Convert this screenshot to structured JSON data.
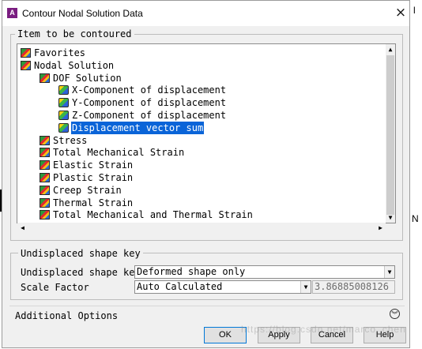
{
  "window": {
    "title": "Contour Nodal Solution Data",
    "close_glyph": "×"
  },
  "edge_right_text": "N",
  "edge_right_top_text": "l",
  "item_group": {
    "legend": "Item to be contoured"
  },
  "tree": [
    {
      "label": "Favorites",
      "icon": "folder-icon",
      "indent": 0,
      "selected": false
    },
    {
      "label": "Nodal Solution",
      "icon": "folder-icon",
      "indent": 0,
      "selected": false
    },
    {
      "label": "DOF Solution",
      "icon": "folder-icon",
      "indent": 1,
      "selected": false
    },
    {
      "label": "X-Component of displacement",
      "icon": "result-item-icon",
      "indent": 2,
      "selected": false
    },
    {
      "label": "Y-Component of displacement",
      "icon": "result-item-icon",
      "indent": 2,
      "selected": false
    },
    {
      "label": "Z-Component of displacement",
      "icon": "result-item-icon",
      "indent": 2,
      "selected": false
    },
    {
      "label": "Displacement vector sum",
      "icon": "result-item-icon",
      "indent": 2,
      "selected": true
    },
    {
      "label": "Stress",
      "icon": "folder-icon",
      "indent": 1,
      "selected": false
    },
    {
      "label": "Total Mechanical Strain",
      "icon": "folder-icon",
      "indent": 1,
      "selected": false
    },
    {
      "label": "Elastic Strain",
      "icon": "folder-icon",
      "indent": 1,
      "selected": false
    },
    {
      "label": "Plastic Strain",
      "icon": "folder-icon",
      "indent": 1,
      "selected": false
    },
    {
      "label": "Creep Strain",
      "icon": "folder-icon",
      "indent": 1,
      "selected": false
    },
    {
      "label": "Thermal Strain",
      "icon": "folder-icon",
      "indent": 1,
      "selected": false
    },
    {
      "label": "Total Mechanical and Thermal Strain",
      "icon": "folder-icon",
      "indent": 1,
      "selected": false
    }
  ],
  "shape_group": {
    "legend": "Undisplaced shape key",
    "undisplaced_label": "Undisplaced shape key",
    "undisplaced_value": "Deformed shape only",
    "scale_label": "Scale Factor",
    "scale_value": "Auto Calculated",
    "scale_number": "3.86885008126"
  },
  "additional_options": {
    "label": "Additional Options"
  },
  "buttons": {
    "ok": "OK",
    "apply": "Apply",
    "cancel": "Cancel",
    "help": "Help"
  },
  "watermark": "https://blog.csdn.net/marco_chen",
  "colors": {
    "selection": "#0a64d8",
    "dialog_bg": "#f0f0f0"
  }
}
